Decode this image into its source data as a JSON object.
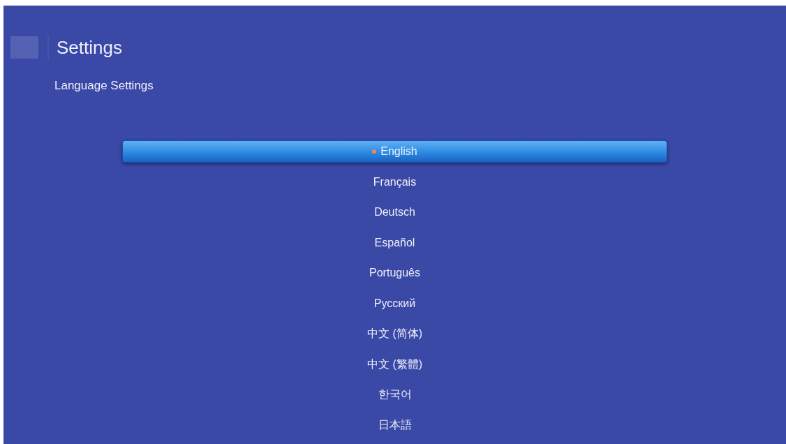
{
  "header": {
    "title": "Settings",
    "subtitle": "Language Settings"
  },
  "languages": [
    {
      "label": "English",
      "selected": true,
      "current": true
    },
    {
      "label": "Français",
      "selected": false,
      "current": false
    },
    {
      "label": "Deutsch",
      "selected": false,
      "current": false
    },
    {
      "label": "Español",
      "selected": false,
      "current": false
    },
    {
      "label": "Português",
      "selected": false,
      "current": false
    },
    {
      "label": "Русский",
      "selected": false,
      "current": false
    },
    {
      "label": "中文 (简体)",
      "selected": false,
      "current": false
    },
    {
      "label": "中文 (繁體)",
      "selected": false,
      "current": false
    },
    {
      "label": "한국어",
      "selected": false,
      "current": false
    },
    {
      "label": "日本語",
      "selected": false,
      "current": false
    }
  ]
}
